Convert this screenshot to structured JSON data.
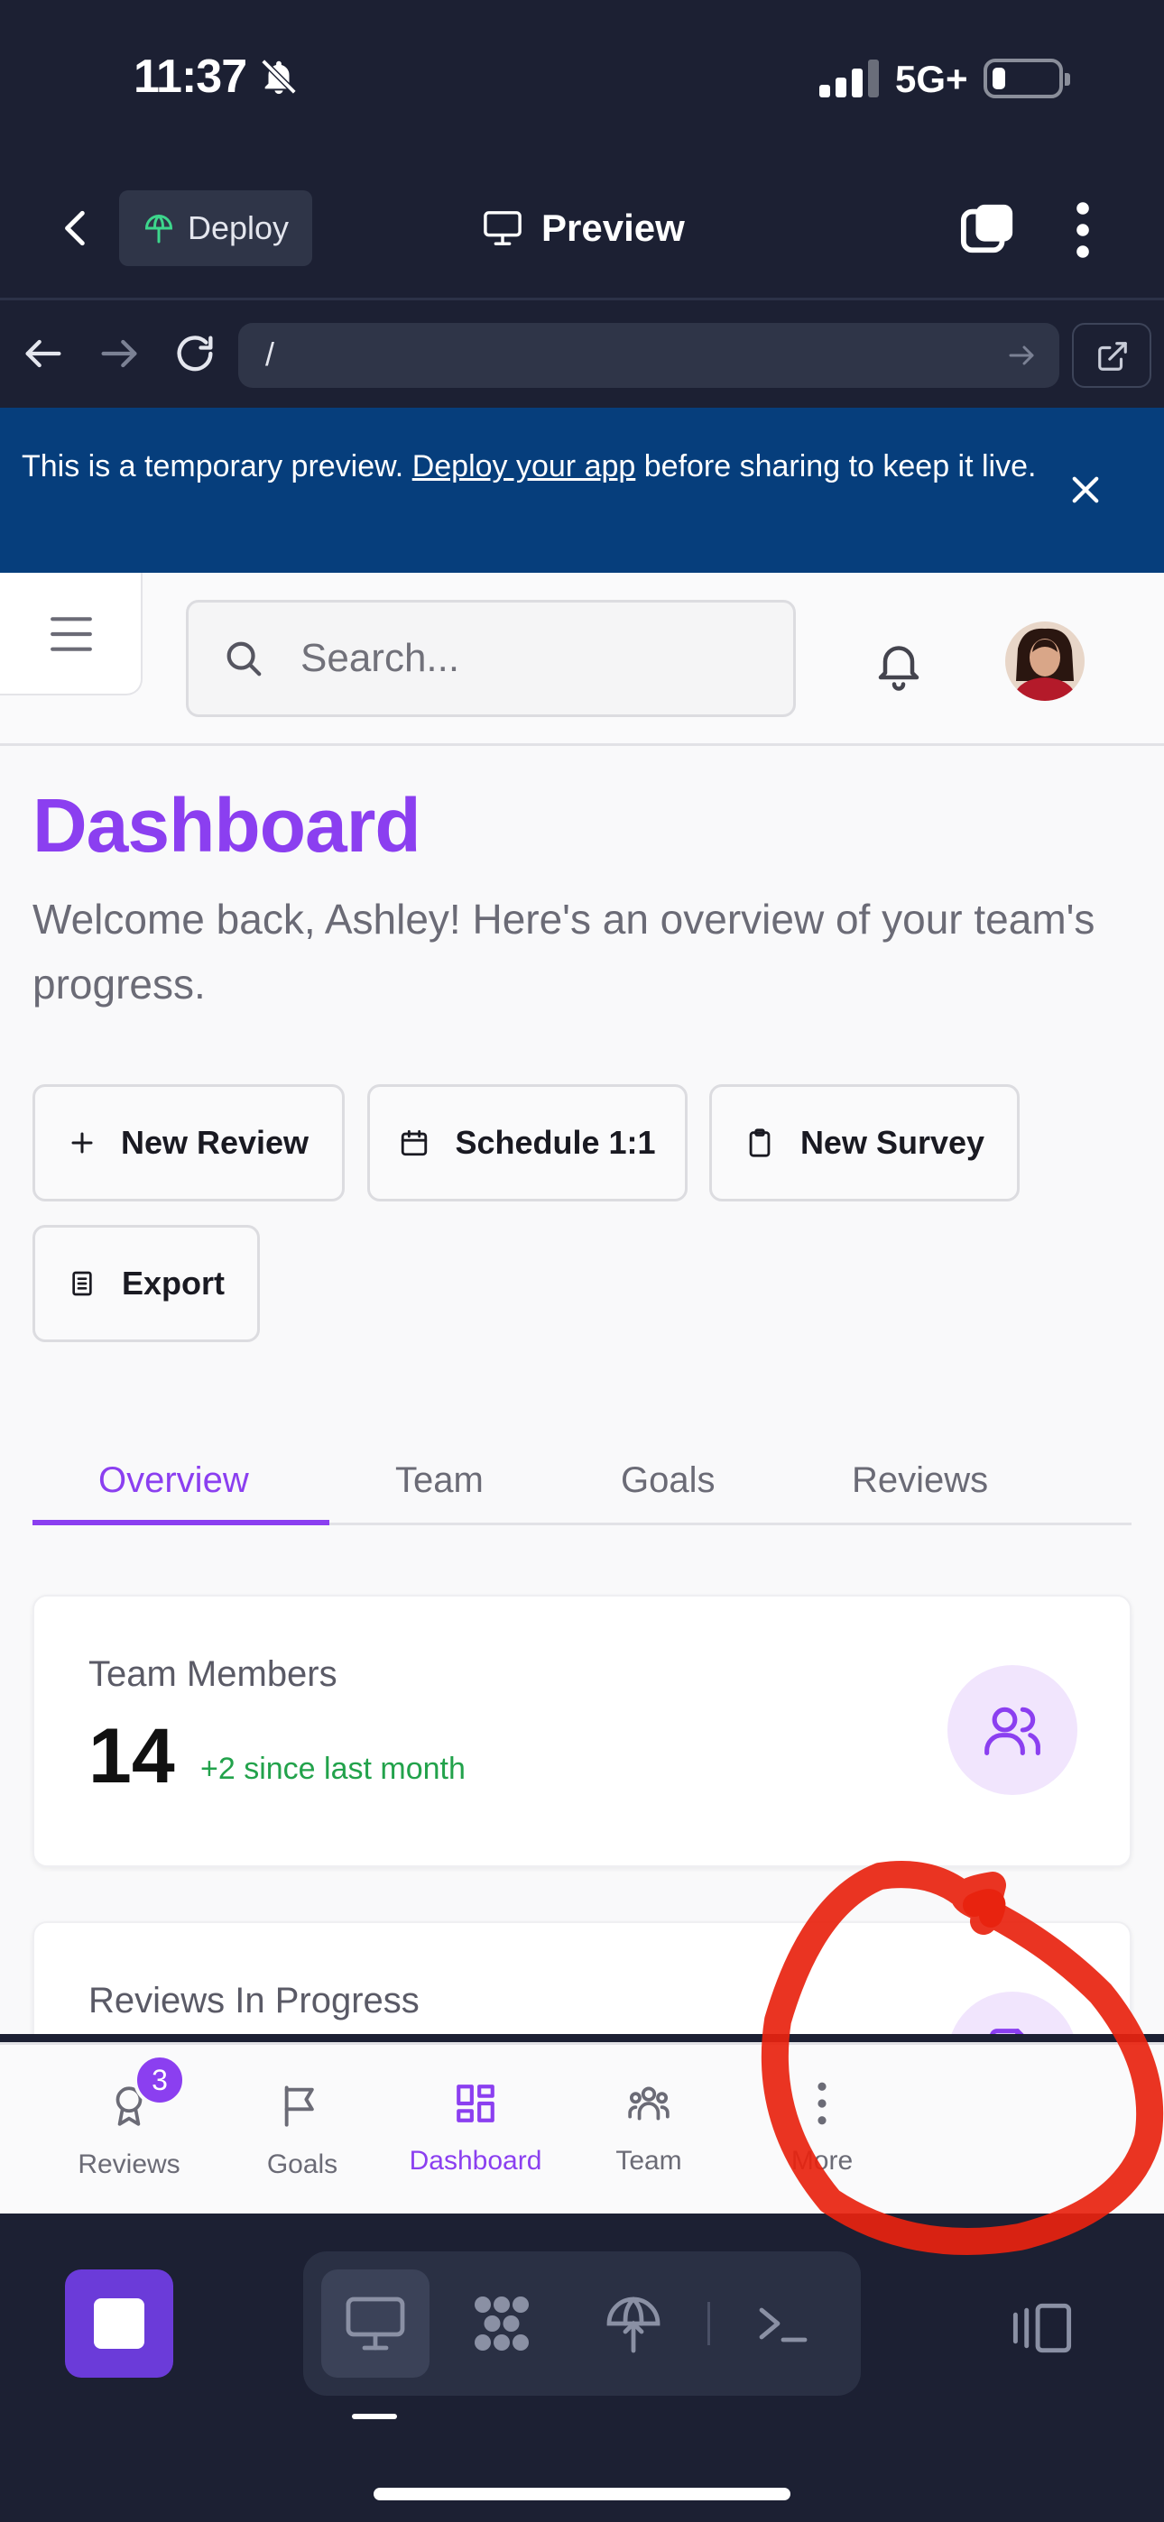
{
  "status_bar": {
    "time": "11:37",
    "network": "5G+"
  },
  "app_bar": {
    "deploy_label": "Deploy",
    "preview_label": "Preview"
  },
  "url_bar": {
    "url": "/"
  },
  "banner": {
    "text_before": "This is a temporary preview. ",
    "link": "Deploy your app",
    "text_after": " before sharing to keep it live."
  },
  "header": {
    "search_placeholder": "Search..."
  },
  "page": {
    "title": "Dashboard",
    "subtitle": "Welcome back, Ashley! Here's an overview of your team's progress."
  },
  "actions": [
    {
      "label": "New Review",
      "icon": "plus-icon"
    },
    {
      "label": "Schedule 1:1",
      "icon": "calendar-icon"
    },
    {
      "label": "New Survey",
      "icon": "clipboard-icon"
    },
    {
      "label": "Export",
      "icon": "document-icon"
    }
  ],
  "tabs": [
    {
      "label": "Overview",
      "active": true
    },
    {
      "label": "Team",
      "active": false
    },
    {
      "label": "Goals",
      "active": false
    },
    {
      "label": "Reviews",
      "active": false
    }
  ],
  "cards": [
    {
      "label": "Team Members",
      "value": "14",
      "delta": "+2 since last month",
      "icon": "users-icon"
    },
    {
      "label": "Reviews In Progress",
      "icon": "file-icon"
    }
  ],
  "bottom_nav": [
    {
      "label": "Reviews",
      "icon": "award-icon",
      "badge": "3",
      "active": false
    },
    {
      "label": "Goals",
      "icon": "flag-icon",
      "active": false
    },
    {
      "label": "Dashboard",
      "icon": "dashboard-icon",
      "active": true
    },
    {
      "label": "Team",
      "icon": "team-icon",
      "active": false
    },
    {
      "label": "More",
      "icon": "more-vertical-icon",
      "active": false
    }
  ],
  "dock": {
    "items": [
      "monitor-icon",
      "apps-icon",
      "deploy-icon",
      "terminal-icon"
    ],
    "active": "monitor-icon"
  },
  "colors": {
    "accent": "#8b3ff0",
    "banner_bg": "#063e7c",
    "chrome_bg": "#1c2033",
    "positive": "#22a24b",
    "annotation": "#e8230f"
  }
}
